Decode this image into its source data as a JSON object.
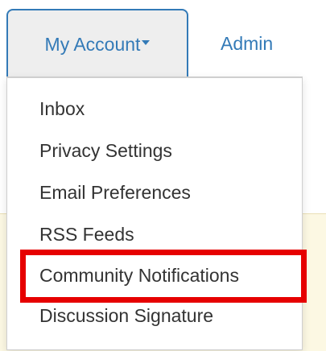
{
  "nav": {
    "active_tab": {
      "label": "My Account",
      "icon": "caret-down-icon"
    },
    "tabs": [
      {
        "label": "Admin"
      }
    ]
  },
  "dropdown": {
    "items": [
      {
        "label": "Inbox"
      },
      {
        "label": "Privacy Settings"
      },
      {
        "label": "Email Preferences"
      },
      {
        "label": "RSS Feeds"
      },
      {
        "label": "Community Notifications",
        "highlighted": true
      },
      {
        "label": "Discussion Signature"
      }
    ]
  },
  "colors": {
    "link": "#337ab7",
    "highlight": "#e60000",
    "menu_text": "#333333",
    "page_background": "#fcf8e3"
  }
}
